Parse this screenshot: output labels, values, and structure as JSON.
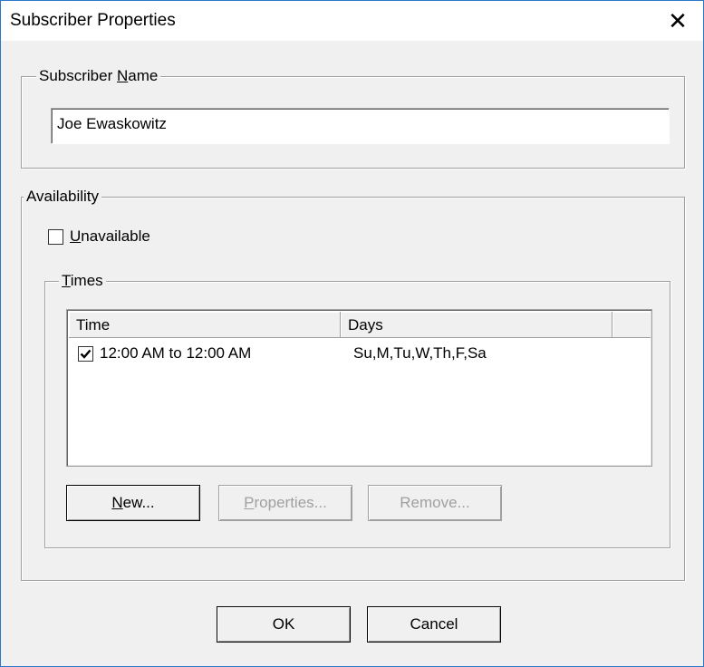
{
  "window": {
    "title": "Subscriber Properties",
    "close_glyph": "✕"
  },
  "subscriber_name": {
    "legend_prefix": "Subscriber ",
    "legend_mnemonic": "N",
    "legend_suffix": "ame",
    "value": "Joe Ewaskowitz"
  },
  "availability": {
    "legend": "Availability",
    "unavailable_mnemonic": "U",
    "unavailable_rest": "navailable",
    "unavailable_checked": false
  },
  "times": {
    "legend_mnemonic": "T",
    "legend_rest": "imes",
    "columns": [
      "Time",
      "Days"
    ],
    "rows": [
      {
        "checked": true,
        "time": "12:00 AM to 12:00 AM",
        "days": "Su,M,Tu,W,Th,F,Sa"
      }
    ],
    "buttons": {
      "new_mnemonic": "N",
      "new_rest": "ew...",
      "properties_mnemonic": "P",
      "properties_rest": "roperties...",
      "remove_label": "Remove..."
    }
  },
  "footer": {
    "ok_label": "OK",
    "cancel_label": "Cancel"
  },
  "colors": {
    "window_border": "#2b78c8",
    "dialog_bg": "#f0f0f0",
    "disabled_text": "#a0a0a0"
  }
}
